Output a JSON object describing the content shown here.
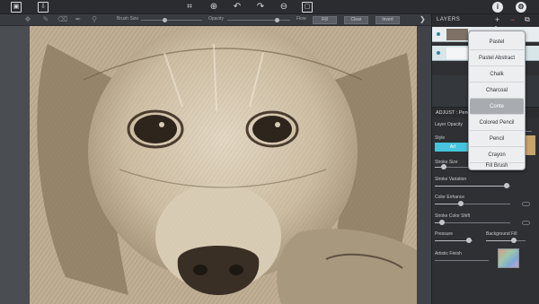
{
  "tool_options": {
    "brush_size_label": "Brush Size",
    "opacity_label": "Opacity",
    "flow_label": "Flow",
    "fill_label": "Fill",
    "clear_label": "Clear",
    "invert_label": "Invert",
    "brush_size_value": 0.4,
    "opacity_value": 0.8
  },
  "layers": {
    "title": "LAYERS",
    "add_icon": "+",
    "remove_icon": "−"
  },
  "adjust": {
    "title": "ADJUST : Penc",
    "layer_opacity_label": "Layer Opacity",
    "style_label": "Style",
    "style_button_label": "Art",
    "stroke_size_label": "Stroke Size",
    "stroke_variation_label": "Stroke Variation",
    "color_enhance_label": "Color Enhance",
    "stroke_color_shift_label": "Stroke Color Shift",
    "pressure_label": "Pressure",
    "background_fill_label": "Background Fill",
    "artistic_finish_label": "Artistic Finish",
    "stroke_size_value": 0.12,
    "stroke_variation_value": 0.95,
    "color_enhance_value": 0.35,
    "stroke_color_shift_value": 0.1,
    "pressure_value": 0.9,
    "background_fill_value": 0.7
  },
  "menu": {
    "items": [
      "Pastel",
      "Pastel Abstract",
      "Chalk",
      "Charcoal",
      "Conte",
      "Colored Pencil",
      "Pencil",
      "Crayon",
      "Fill Brush"
    ],
    "active_index": 4
  },
  "colors": {
    "accent": "#45c4dc",
    "panel_bg": "#2e3034",
    "canvas_sepia": "#c4b39a"
  }
}
